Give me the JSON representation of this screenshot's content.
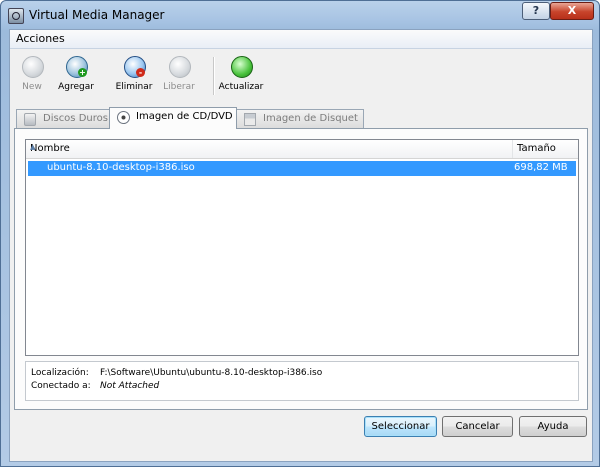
{
  "window": {
    "title": "Virtual Media Manager",
    "help_glyph": "?",
    "close_glyph": "X"
  },
  "menu": {
    "items": [
      "Acciones"
    ]
  },
  "toolbar": {
    "new_label": "New",
    "add_label": "Agregar",
    "delete_label": "Eliminar",
    "release_label": "Liberar",
    "refresh_label": "Actualizar"
  },
  "tabs": [
    {
      "label": "Discos Duros",
      "icon": "hard-disk-icon",
      "active": false
    },
    {
      "label": "Imagen de CD/DVD",
      "icon": "cd-dvd-icon",
      "active": true
    },
    {
      "label": "Imagen de Disquet",
      "icon": "floppy-icon",
      "active": false
    }
  ],
  "list": {
    "columns": [
      "Nombre",
      "Tamaño"
    ],
    "rows": [
      {
        "name": "ubuntu-8.10-desktop-i386.iso",
        "size": "698,82 MB",
        "selected": true
      }
    ]
  },
  "info": {
    "location_label": "Localización:",
    "location_value": "F:\\Software\\Ubuntu\\ubuntu-8.10-desktop-i386.iso",
    "attached_label": "Conectado a:",
    "attached_value": "Not Attached"
  },
  "buttons": {
    "select": "Seleccionar",
    "cancel": "Cancelar",
    "help": "Ayuda"
  },
  "colors": {
    "selection": "#3399ff",
    "title_gradient": "#b9d1ea",
    "close_button": "#c7442b"
  }
}
